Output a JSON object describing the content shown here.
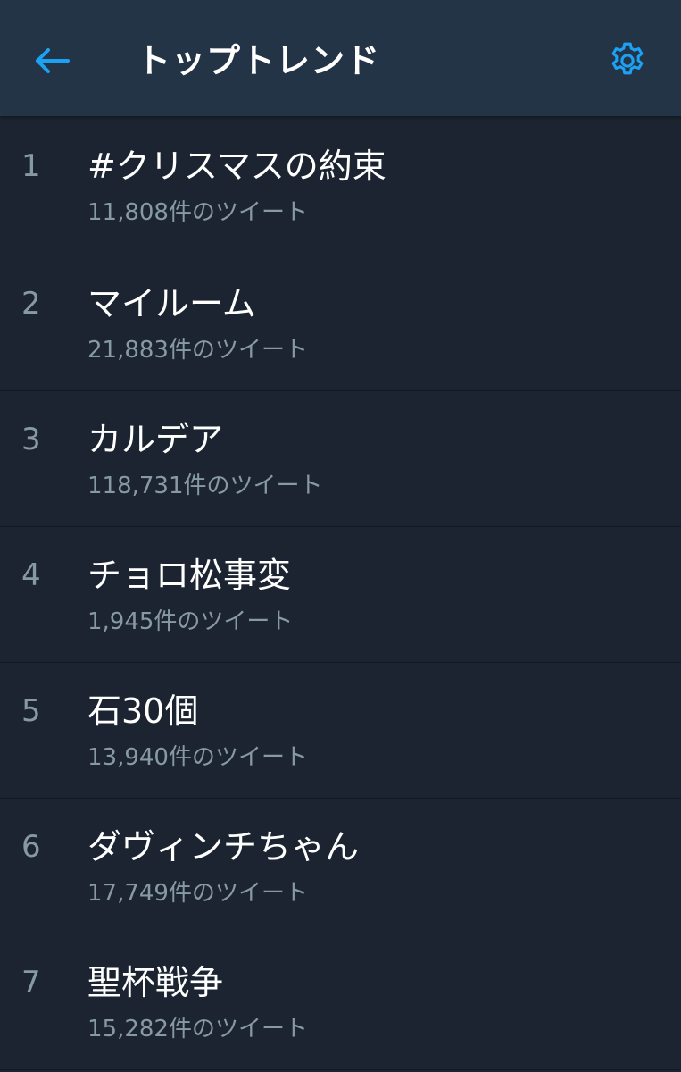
{
  "header": {
    "title": "トップトレンド",
    "back_icon": "arrow-left-icon",
    "settings_icon": "gear-icon"
  },
  "trends": [
    {
      "rank": "1",
      "name": "#クリスマスの約束",
      "count": "11,808件のツイート"
    },
    {
      "rank": "2",
      "name": "マイルーム",
      "count": "21,883件のツイート"
    },
    {
      "rank": "3",
      "name": "カルデア",
      "count": "118,731件のツイート"
    },
    {
      "rank": "4",
      "name": "チョロ松事変",
      "count": "1,945件のツイート"
    },
    {
      "rank": "5",
      "name": "石30個",
      "count": "13,940件のツイート"
    },
    {
      "rank": "6",
      "name": "ダヴィンチちゃん",
      "count": "17,749件のツイート"
    },
    {
      "rank": "7",
      "name": "聖杯戦争",
      "count": "15,282件のツイート"
    }
  ],
  "colors": {
    "background": "#1b2430",
    "header_background": "#243447",
    "accent": "#1da1f2",
    "secondary_text": "#8899a6"
  }
}
